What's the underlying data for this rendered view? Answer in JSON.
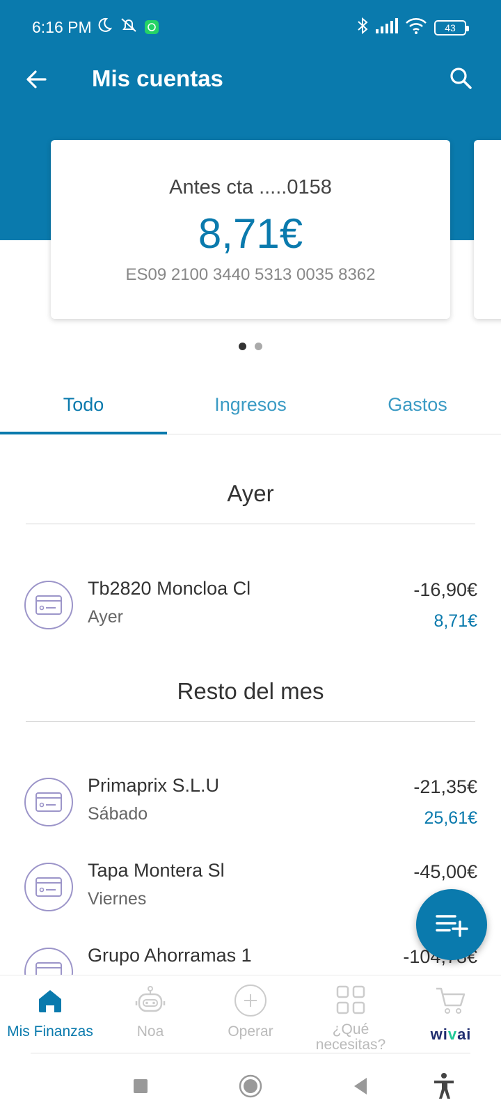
{
  "status_bar": {
    "time": "6:16 PM",
    "battery": "43",
    "icons": [
      "moon-icon",
      "alarm-off-icon",
      "whatsapp-icon",
      "bluetooth-icon",
      "signal-icon",
      "wifi-icon",
      "battery-icon"
    ]
  },
  "app_bar": {
    "title": "Mis cuentas",
    "back_icon": "arrow-left-icon",
    "search_icon": "search-icon"
  },
  "account_card": {
    "name": "Antes cta .....0158",
    "balance": "8,71€",
    "iban": "ES09 2100 3440 5313 0035 8362"
  },
  "carousel": {
    "pages": 2,
    "active": 1
  },
  "tabs": [
    {
      "label": "Todo",
      "active": true
    },
    {
      "label": "Ingresos",
      "active": false
    },
    {
      "label": "Gastos",
      "active": false
    }
  ],
  "sections": [
    {
      "title": "Ayer",
      "transactions": [
        {
          "name": "Tb2820 Moncloa Cl",
          "date": "Ayer",
          "amount": "-16,90€",
          "balance": "8,71€"
        }
      ]
    },
    {
      "title": "Resto del mes",
      "transactions": [
        {
          "name": "Primaprix S.L.U",
          "date": "Sábado",
          "amount": "-21,35€",
          "balance": "25,61€"
        },
        {
          "name": "Tapa Montera Sl",
          "date": "Viernes",
          "amount": "-45,00€",
          "balance": ""
        },
        {
          "name": "Grupo Ahorramas 1",
          "date": "",
          "amount": "-104,78€",
          "balance": ""
        }
      ]
    }
  ],
  "fab": {
    "icon": "playlist-add-icon"
  },
  "bottom_nav": [
    {
      "label": "Mis Finanzas",
      "icon": "home-icon",
      "active": true
    },
    {
      "label": "Noa",
      "icon": "robot-icon",
      "active": false
    },
    {
      "label": "Operar",
      "icon": "plus-circle-icon",
      "active": false
    },
    {
      "label": "¿Qué necesitas?",
      "icon": "grid-icon",
      "active": false
    },
    {
      "label": "wivai",
      "icon": "cart-icon",
      "active": false
    }
  ],
  "colors": {
    "primary": "#0a7aad",
    "tab_inactive": "#3b9bc4",
    "icon_ring": "#9c95c9",
    "wivai_dark": "#1f2d6e",
    "wivai_green": "#20c997"
  }
}
